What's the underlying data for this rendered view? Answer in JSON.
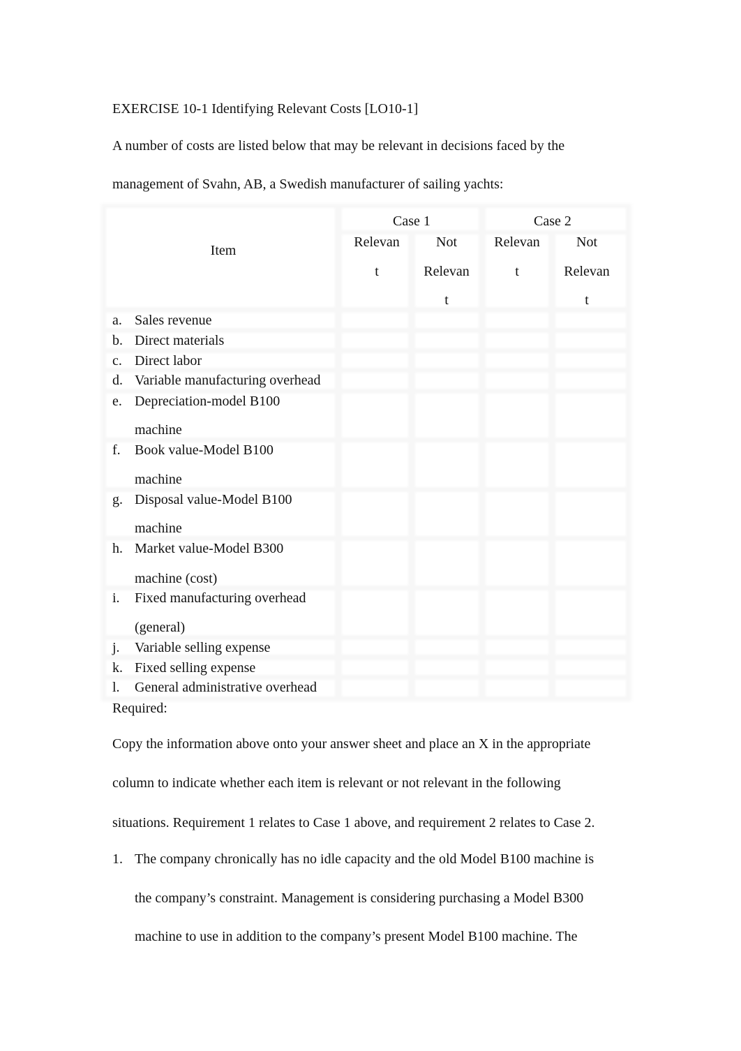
{
  "document": {
    "title": "EXERCISE 10-1 Identifying Relevant Costs [LO10-1]",
    "intro_lines": [
      "A number of costs are listed below that may be relevant in decisions faced by the",
      "management of Svahn, AB, a Swedish manufacturer of sailing yachts:"
    ],
    "table": {
      "item_header": "Item",
      "cases": [
        {
          "label": "Case 1",
          "relevant_lines": [
            "Relevan",
            "t"
          ],
          "not_relevant_lines": [
            "Not",
            "Relevan",
            "t"
          ]
        },
        {
          "label": "Case 2",
          "relevant_lines": [
            "Relevan",
            "t"
          ],
          "not_relevant_lines": [
            "Not",
            "Relevan",
            "t"
          ]
        }
      ],
      "rows": [
        {
          "letter": "a.",
          "lines": [
            "Sales revenue"
          ]
        },
        {
          "letter": "b.",
          "lines": [
            "Direct materials"
          ]
        },
        {
          "letter": "c.",
          "lines": [
            "Direct labor"
          ]
        },
        {
          "letter": "d.",
          "lines": [
            "Variable manufacturing overhead"
          ]
        },
        {
          "letter": "e.",
          "lines": [
            "Depreciation-model B100",
            "machine"
          ]
        },
        {
          "letter": "f.",
          "lines": [
            "Book value-Model B100",
            "machine"
          ]
        },
        {
          "letter": "g.",
          "lines": [
            "Disposal value-Model B100",
            "machine"
          ]
        },
        {
          "letter": "h.",
          "lines": [
            "Market value-Model B300",
            "machine (cost)"
          ]
        },
        {
          "letter": "i.",
          "lines": [
            "Fixed manufacturing overhead",
            "(general)"
          ]
        },
        {
          "letter": "j.",
          "lines": [
            "Variable selling expense"
          ]
        },
        {
          "letter": "k.",
          "lines": [
            "Fixed selling expense"
          ]
        },
        {
          "letter": "l.",
          "lines": [
            "General administrative overhead"
          ]
        }
      ]
    },
    "required_label": "Required:",
    "required_lines": [
      "Copy the information above onto your answer sheet and place an X in the appropriate",
      "column to indicate whether each item is relevant or not relevant in the following",
      "situations. Requirement 1 relates to Case 1 above, and requirement 2 relates to Case 2."
    ],
    "requirements": [
      {
        "number": "1.",
        "lines": [
          "The company chronically has no idle capacity and the old Model B100 machine is",
          "the company’s constraint. Management is considering purchasing a Model B300",
          "machine to use in addition to the company’s present Model B100 machine. The"
        ]
      }
    ]
  }
}
